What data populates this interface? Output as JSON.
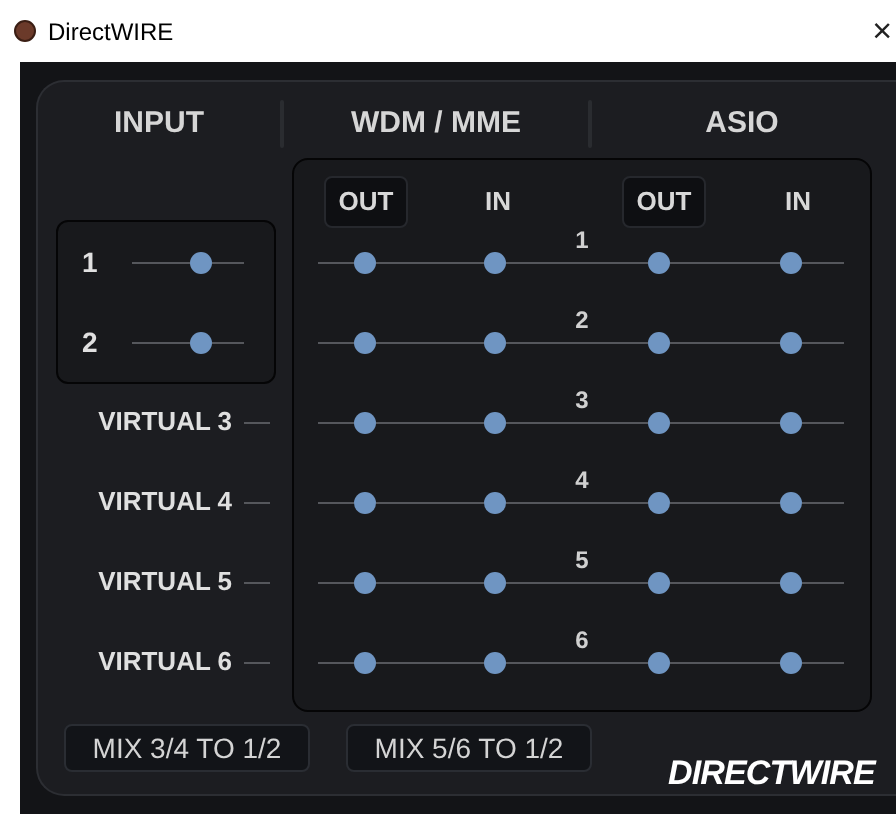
{
  "window": {
    "title": "DirectWIRE",
    "close": "×"
  },
  "column_groups": [
    {
      "label": "INPUT"
    },
    {
      "label": "WDM / MME"
    },
    {
      "label": "ASIO"
    }
  ],
  "matrix_columns": [
    {
      "label": "OUT",
      "highlighted": true
    },
    {
      "label": "IN",
      "highlighted": false
    },
    {
      "label": "OUT",
      "highlighted": true
    },
    {
      "label": "IN",
      "highlighted": false
    }
  ],
  "inputs": [
    {
      "label": "1",
      "kind": "hardware"
    },
    {
      "label": "2",
      "kind": "hardware"
    },
    {
      "label": "VIRTUAL 3",
      "kind": "virtual"
    },
    {
      "label": "VIRTUAL 4",
      "kind": "virtual"
    },
    {
      "label": "VIRTUAL 5",
      "kind": "virtual"
    },
    {
      "label": "VIRTUAL 6",
      "kind": "virtual"
    }
  ],
  "channels": [
    {
      "number": "1"
    },
    {
      "number": "2"
    },
    {
      "number": "3"
    },
    {
      "number": "4"
    },
    {
      "number": "5"
    },
    {
      "number": "6"
    }
  ],
  "buttons": [
    "MIX 3/4 TO 1/2",
    "MIX 5/6 TO 1/2"
  ],
  "logo": "DIRECTWIRE"
}
